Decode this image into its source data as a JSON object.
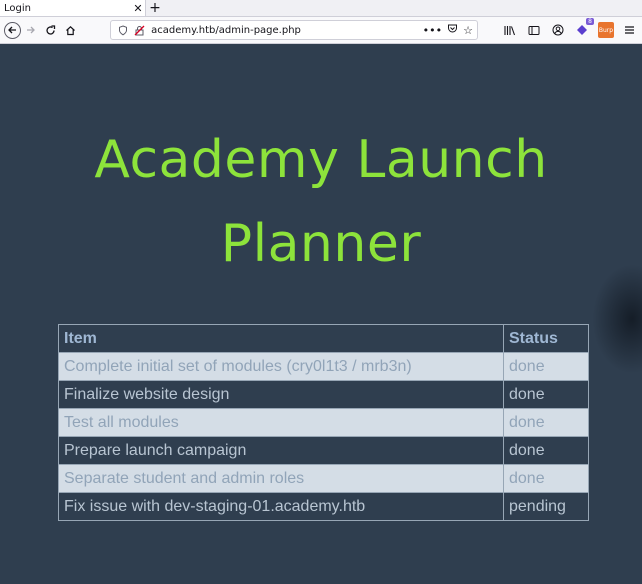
{
  "browser": {
    "tab_title": "Login",
    "tab_close": "✕",
    "new_tab": "+",
    "url": "academy.htb/admin-page.php",
    "url_more": "•••",
    "burp_label": "Burp",
    "ext_badge": "8"
  },
  "page": {
    "title_line1": "Academy Launch",
    "title_line2": "Planner",
    "title_color": "#8de33b",
    "background": "#2f3e4f"
  },
  "table": {
    "headers": [
      "Item",
      "Status"
    ],
    "rows": [
      {
        "item": "Complete initial set of modules (cry0l1t3 / mrb3n)",
        "status": "done"
      },
      {
        "item": "Finalize website design",
        "status": "done"
      },
      {
        "item": "Test all modules",
        "status": "done"
      },
      {
        "item": "Prepare launch campaign",
        "status": "done"
      },
      {
        "item": "Separate student and admin roles",
        "status": "done"
      },
      {
        "item": "Fix issue with dev-staging-01.academy.htb",
        "status": "pending"
      }
    ]
  }
}
